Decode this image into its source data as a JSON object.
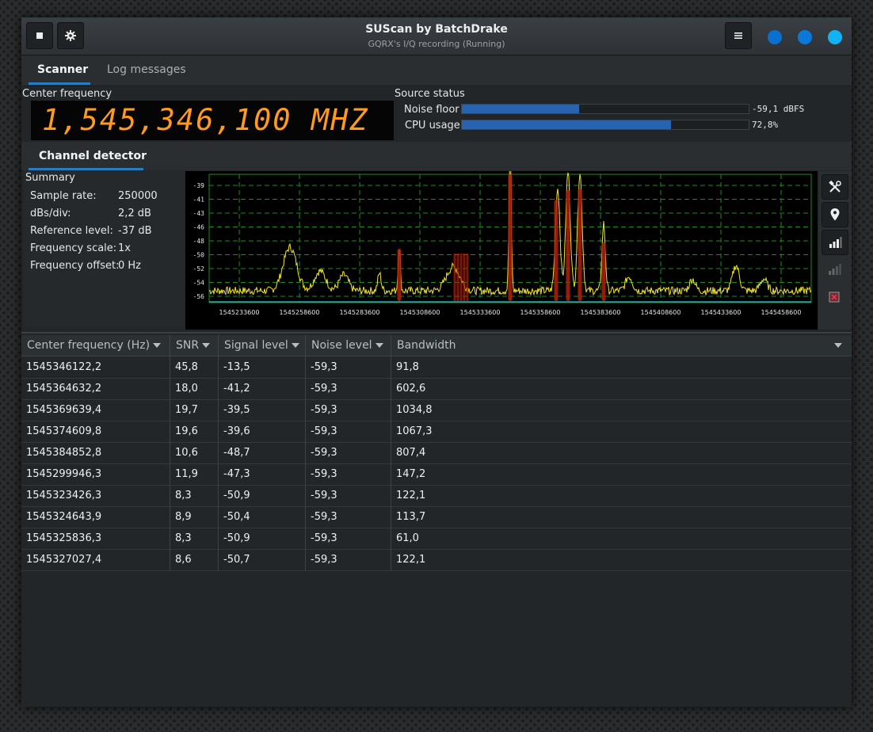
{
  "window": {
    "title": "SUScan by BatchDrake",
    "subtitle": "GQRX's I/Q recording (Running)",
    "dot_colors": [
      "#0a6fce",
      "#0a79d9",
      "#12b3f2"
    ]
  },
  "header": {
    "stop_icon": "stop-icon",
    "settings_icon": "gear-icon",
    "menu_icon": "hamburger-menu-icon"
  },
  "tabs": [
    {
      "label": "Scanner",
      "active": true
    },
    {
      "label": "Log messages",
      "active": false
    }
  ],
  "center_frequency": {
    "label": "Center frequency",
    "display": "1,545,346,100 MHZ"
  },
  "source_status": {
    "title": "Source status",
    "meters": [
      {
        "label": "Noise floor",
        "value": "-59,1 dBFS",
        "fraction": 0.41
      },
      {
        "label": "CPU usage",
        "value": "72,8%",
        "fraction": 0.728
      }
    ]
  },
  "channel_detector_tab": "Channel detector",
  "summary": {
    "title": "Summary",
    "rows": [
      {
        "label": "Sample rate:",
        "value": "250000"
      },
      {
        "label": "dBs/div:",
        "value": "2,2 dB"
      },
      {
        "label": "Reference level:",
        "value": "-37 dB"
      },
      {
        "label": "Frequency scale:",
        "value": "1x"
      },
      {
        "label": "Frequency offset:",
        "value": "0 Hz"
      }
    ]
  },
  "spectrum": {
    "y_ticks": [
      "-39",
      "-41",
      "-43",
      "-46",
      "-48",
      "-50",
      "-52",
      "-54",
      "-56"
    ],
    "x_ticks": [
      "1545233600",
      "1545258600",
      "1545283600",
      "1545308600",
      "1545333600",
      "1545358600",
      "1545383600",
      "1545408600",
      "1545433600",
      "1545458600"
    ],
    "trace_color": "#f0e62a",
    "channel_color": "#b3200c",
    "grid_color": "#1e8a1e"
  },
  "toolbar": {
    "icons": [
      "tools-icon",
      "location-pin-icon",
      "signal-bars-icon",
      "signal-bars-dim-icon",
      "delete-icon"
    ]
  },
  "table": {
    "columns": [
      "Center frequency (Hz)",
      "SNR",
      "Signal level",
      "Noise level",
      "Bandwidth"
    ],
    "rows": [
      [
        "1545346122,2",
        "45,8",
        "-13,5",
        "-59,3",
        "91,8"
      ],
      [
        "1545364632,2",
        "18,0",
        "-41,2",
        "-59,3",
        "602,6"
      ],
      [
        "1545369639,4",
        "19,7",
        "-39,5",
        "-59,3",
        "1034,8"
      ],
      [
        "1545374609,8",
        "19,6",
        "-39,6",
        "-59,3",
        "1067,3"
      ],
      [
        "1545384852,8",
        "10,6",
        "-48,7",
        "-59,3",
        "807,4"
      ],
      [
        "1545299946,3",
        "11,9",
        "-47,3",
        "-59,3",
        "147,2"
      ],
      [
        "1545323426,3",
        "8,3",
        "-50,9",
        "-59,3",
        "122,1"
      ],
      [
        "1545324643,9",
        "8,9",
        "-50,4",
        "-59,3",
        "113,7"
      ],
      [
        "1545325836,3",
        "8,3",
        "-50,9",
        "-59,3",
        "61,0"
      ],
      [
        "1545327027,4",
        "8,6",
        "-50,7",
        "-59,3",
        "122,1"
      ]
    ]
  }
}
